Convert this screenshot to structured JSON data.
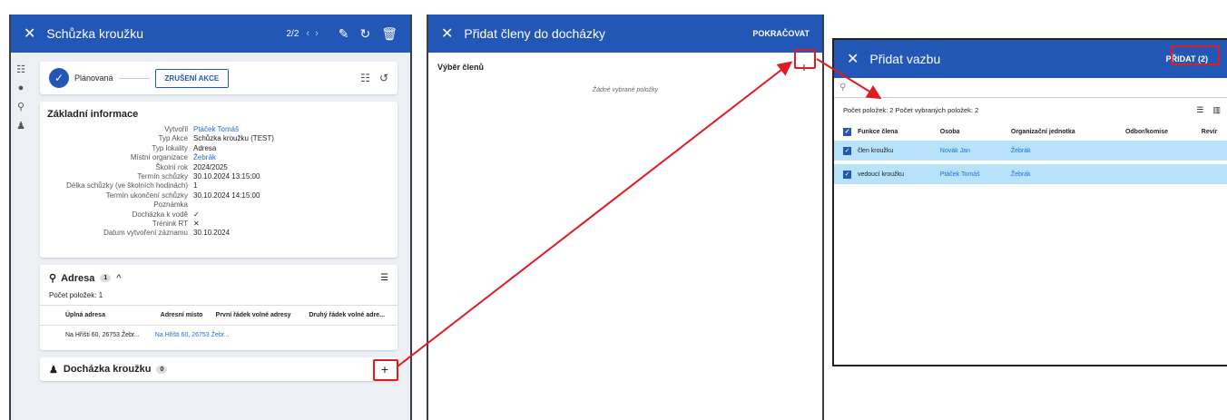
{
  "p1": {
    "title": "Schůzka kroužku",
    "counter": "2/2",
    "status": "Plánovaná",
    "cancel": "ZRUŠENÍ AKCE",
    "section": "Základní informace",
    "info": [
      {
        "l": "Vytvořil",
        "v": "Ptáček Tomáš",
        "link": true
      },
      {
        "l": "Typ Akce",
        "v": "Schůzka kroužku (TEST)"
      },
      {
        "l": "Typ lokality",
        "v": "Adresa"
      },
      {
        "l": "Místní organizace",
        "v": "Žebrák",
        "link": true
      },
      {
        "l": "Školní rok",
        "v": "2024/2025"
      },
      {
        "l": "Termín schůzky",
        "v": "30.10.2024 13:15:00"
      },
      {
        "l": "Délka schůzky (ve školních hodinách)",
        "v": "1"
      },
      {
        "l": "Termín ukončení schůzky",
        "v": "30.10.2024 14:15:00"
      },
      {
        "l": "Poznámka",
        "v": ""
      },
      {
        "l": "Docházka k vodě",
        "v": "✓"
      },
      {
        "l": "Trénink RT",
        "v": "✕"
      },
      {
        "l": "Datum vytvoření záznamu",
        "v": "30.10.2024"
      }
    ],
    "addr": {
      "title": "Adresa",
      "badge": "1",
      "count": "Počet položek: 1",
      "cols": [
        "Úplná adresa",
        "Adresní místo",
        "První řádek volné adresy",
        "Druhý řádek volné adre..."
      ],
      "row": [
        "Na Hřišti 60, 26753 Žebr...",
        "Na Hřišti 60, 26753 Žebr..."
      ]
    },
    "att": {
      "title": "Docházka kroužku",
      "badge": "0"
    }
  },
  "p2": {
    "title": "Přidat členy do docházky",
    "action": "POKRAČOVAT",
    "section": "Výběr členů",
    "empty": "Žádné vybrané položky"
  },
  "p3": {
    "title": "Přidat vazbu",
    "action": "PŘIDAT (2)",
    "summary": "Počet položek: 2   Počet vybraných položek: 2",
    "cols": [
      "Funkce člena",
      "Osoba",
      "Organizační jednotka",
      "Odbor/komise",
      "Revír"
    ],
    "rows": [
      [
        "člen kroužku",
        "Novák Jan",
        "Žebrák"
      ],
      [
        "vedoucí kroužku",
        "Ptáček Tomáš",
        "Žebrák"
      ]
    ]
  },
  "colors": {
    "header": "#2357b6",
    "highlight": "#e01b22",
    "row": "#b8e1fb"
  }
}
